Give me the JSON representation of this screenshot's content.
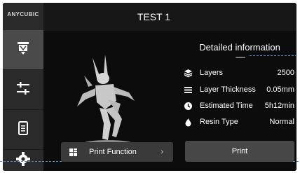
{
  "sidebar": {
    "brand": "ANYCUBIC",
    "items": [
      {
        "icon": "print-job-icon",
        "active": true
      },
      {
        "icon": "sliders-icon",
        "active": false
      },
      {
        "icon": "files-icon",
        "active": false
      },
      {
        "icon": "gear-icon",
        "active": false
      }
    ]
  },
  "header": {
    "title": "TEST 1"
  },
  "details": {
    "title": "Detailed information",
    "rows": [
      {
        "icon": "layers-icon",
        "label": "Layers",
        "value": "2500"
      },
      {
        "icon": "layer-thickness-icon",
        "label": "Layer Thickness",
        "value": "0.05mm"
      },
      {
        "icon": "clock-icon",
        "label": "Estimated Time",
        "value": "5h12min"
      },
      {
        "icon": "resin-drop-icon",
        "label": "Resin Type",
        "value": "Normal"
      }
    ]
  },
  "actions": {
    "print_function": "Print Function",
    "print": "Print"
  },
  "colors": {
    "panel_bg": "#171717",
    "sidebar_bg": "#2a2a2a",
    "active_tab": "#4a4a4a",
    "button_bg": "#3a3a3a",
    "print_button_bg": "#474747",
    "text": "#ffffff",
    "dash_annotation": "#5b8ac8"
  }
}
